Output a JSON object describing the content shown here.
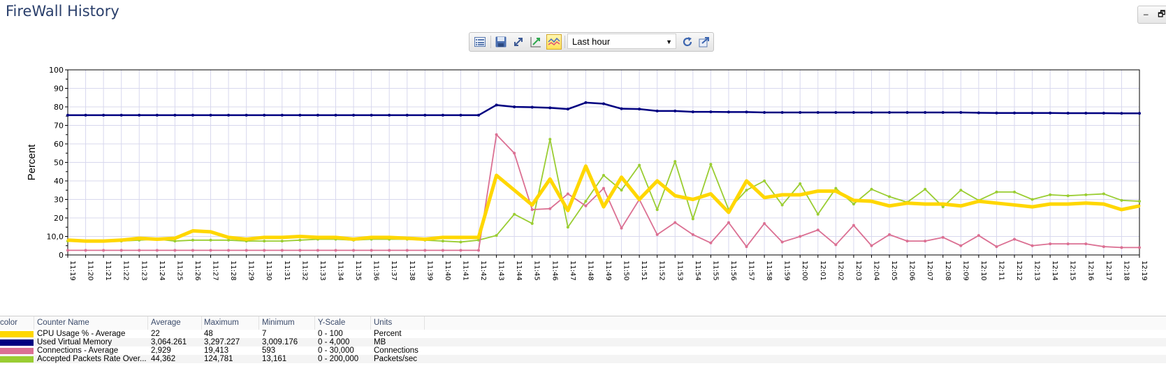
{
  "page": {
    "title": "FireWall History"
  },
  "window_buttons": {
    "minimize": "–",
    "restore": "🗗"
  },
  "toolbar": {
    "buttons": [
      {
        "name": "legend-toggle",
        "icon": "list-icon"
      },
      {
        "name": "save",
        "icon": "save-icon"
      },
      {
        "name": "expand",
        "icon": "expand-icon"
      },
      {
        "name": "scale",
        "icon": "scale-chart-icon"
      },
      {
        "name": "chart-style",
        "icon": "line-chart-icon",
        "active": true
      }
    ],
    "time_range": "Last hour",
    "refresh_icon": "refresh-icon",
    "export_icon": "export-icon"
  },
  "legend": {
    "headers": [
      "color",
      "Counter Name",
      "Average",
      "Maximum",
      "Minimum",
      "Y-Scale",
      "Units"
    ],
    "rows": [
      {
        "color": "#ffd700",
        "name": "CPU Usage % - Average",
        "average": "22",
        "maximum": "48",
        "minimum": "7",
        "yscale": "0 - 100",
        "units": "Percent"
      },
      {
        "color": "#000080",
        "name": "Used Virtual Memory",
        "average": "3,064.261",
        "maximum": "3,297.227",
        "minimum": "3,009.176",
        "yscale": "0 - 4,000",
        "units": "MB"
      },
      {
        "color": "#db7093",
        "name": "Connections - Average",
        "average": "2,929",
        "maximum": "19,413",
        "minimum": "593",
        "yscale": "0 - 30,000",
        "units": "Connections"
      },
      {
        "color": "#9acd32",
        "name": "Accepted Packets Rate Over...",
        "average": "44,362",
        "maximum": "124,781",
        "minimum": "13,161",
        "yscale": "0 - 200,000",
        "units": "Packets/sec"
      }
    ]
  },
  "chart_data": {
    "type": "line",
    "ylabel": "Percent",
    "ylim": [
      0,
      100
    ],
    "yticks": [
      "0",
      "10,0",
      "20",
      "30",
      "40",
      "50",
      "60",
      "70",
      "80",
      "90",
      "100"
    ],
    "grid": true,
    "x": [
      "11:19",
      "11:20",
      "11:21",
      "11:22",
      "11:23",
      "11:24",
      "11:25",
      "11:26",
      "11:27",
      "11:28",
      "11:29",
      "11:30",
      "11:31",
      "11:32",
      "11:33",
      "11:34",
      "11:35",
      "11:36",
      "11:37",
      "11:38",
      "11:39",
      "11:40",
      "11:41",
      "11:42",
      "11:43",
      "11:44",
      "11:45",
      "11:46",
      "11:47",
      "11:48",
      "11:49",
      "11:50",
      "11:51",
      "11:52",
      "11:53",
      "11:54",
      "11:55",
      "11:56",
      "11:57",
      "11:58",
      "11:59",
      "12:00",
      "12:01",
      "12:02",
      "12:03",
      "12:04",
      "12:05",
      "12:06",
      "12:07",
      "12:08",
      "12:09",
      "12:10",
      "12:11",
      "12:12",
      "12:13",
      "12:14",
      "12:15",
      "12:16",
      "12:17",
      "12:18",
      "12:19"
    ],
    "series": [
      {
        "color": "#000080",
        "width": 2.5,
        "values": [
          75.5,
          75.5,
          75.5,
          75.5,
          75.5,
          75.5,
          75.5,
          75.5,
          75.5,
          75.5,
          75.5,
          75.5,
          75.5,
          75.5,
          75.5,
          75.5,
          75.5,
          75.5,
          75.5,
          75.5,
          75.5,
          75.5,
          75.5,
          75.5,
          81,
          80,
          79.8,
          79.5,
          78.8,
          82.3,
          81.7,
          79,
          78.8,
          77.8,
          77.8,
          77.3,
          77.3,
          77.2,
          77.2,
          77,
          77,
          77,
          77,
          77,
          77,
          77,
          77,
          77,
          77,
          77,
          77,
          76.8,
          76.7,
          76.7,
          76.7,
          76.7,
          76.6,
          76.6,
          76.6,
          76.5,
          76.5
        ]
      },
      {
        "color": "#9acd32",
        "width": 1.8,
        "values": [
          7.5,
          7.5,
          7.5,
          7.5,
          8,
          8.5,
          7.5,
          8,
          8,
          8,
          7.5,
          7.5,
          7.5,
          8,
          8.5,
          8.5,
          8,
          8.5,
          8.5,
          8.5,
          8,
          7.5,
          7,
          8,
          10.5,
          22,
          17,
          62.5,
          15,
          29,
          43,
          35,
          48.5,
          24.5,
          50.5,
          19.5,
          49,
          24.5,
          35,
          40,
          27,
          38.5,
          22,
          36,
          27.5,
          35.5,
          31.5,
          28.5,
          35.5,
          26,
          35,
          29.5,
          34,
          34,
          30,
          32.5,
          32,
          32.5,
          33,
          29.5,
          29
        ]
      },
      {
        "color": "#db7093",
        "width": 1.8,
        "values": [
          2.5,
          2.5,
          2.5,
          2.5,
          2.5,
          2.5,
          2.5,
          2.5,
          2.5,
          2.5,
          2.5,
          2.5,
          2.5,
          2.5,
          2.5,
          2.5,
          2.5,
          2.5,
          2.5,
          2.5,
          2.5,
          2.5,
          2.5,
          2.5,
          65,
          55,
          24.5,
          25,
          33,
          26.5,
          36,
          14.5,
          30,
          11,
          17.5,
          11,
          6.5,
          17.5,
          4.5,
          17,
          7,
          10,
          13.5,
          5.5,
          16,
          5,
          11,
          7.5,
          7.5,
          9.5,
          5,
          10.5,
          4.5,
          8.5,
          5,
          6,
          6,
          6,
          4.5,
          4,
          4
        ]
      },
      {
        "color": "#ffd700",
        "width": 5,
        "values": [
          8,
          7.5,
          7.5,
          8,
          9,
          8.5,
          9,
          13,
          12.5,
          9.5,
          8.5,
          9.5,
          9.5,
          10,
          9.5,
          9.5,
          8.5,
          9.5,
          9.5,
          9,
          8.5,
          9.5,
          9.5,
          9.5,
          43,
          35,
          27,
          41,
          24,
          48,
          26,
          42,
          30,
          40,
          32,
          30,
          33,
          23,
          40,
          31,
          32.5,
          32.5,
          34.5,
          34.5,
          29.5,
          29,
          26.5,
          28,
          27.5,
          27.5,
          26.5,
          29,
          28,
          27,
          26,
          27.5,
          27.5,
          28,
          27.5,
          24.5,
          26.5
        ]
      }
    ]
  }
}
